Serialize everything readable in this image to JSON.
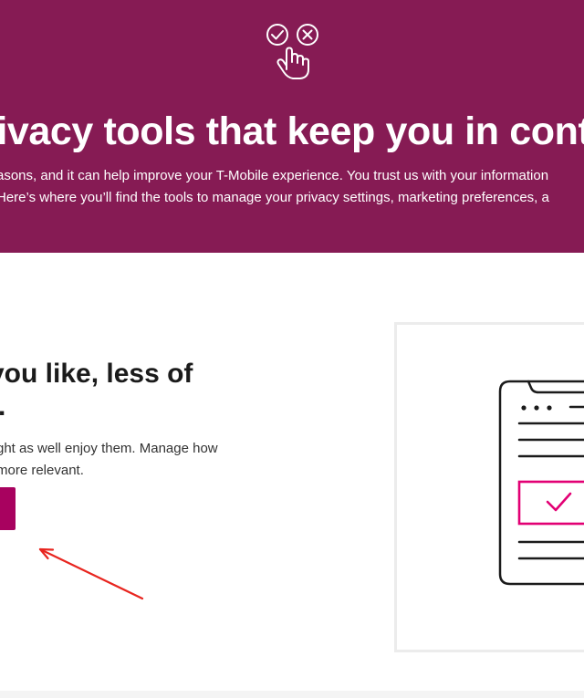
{
  "hero": {
    "icon": "privacy-controls-icon",
    "background_color": "#861b54",
    "title": "rivacy tools that keep you in contro",
    "description_line_1": "asons, and it can help improve your T-Mobile experience. You trust us with your information",
    "description_line_2": "Here’s where you’ll find the tools to manage your privacy settings, marketing preferences, a"
  },
  "section": {
    "heading_line_1": "you like, less of",
    "heading_line_2": "t.",
    "body_line_1": "ght as well enjoy them. Manage how",
    "body_line_2": "more relevant.",
    "button_color": "#a8025f",
    "illustration": "checklist-document-icon",
    "accent_color": "#e20074"
  },
  "annotation": {
    "arrow": "red-arrow-annotation",
    "color": "#e8251f"
  }
}
